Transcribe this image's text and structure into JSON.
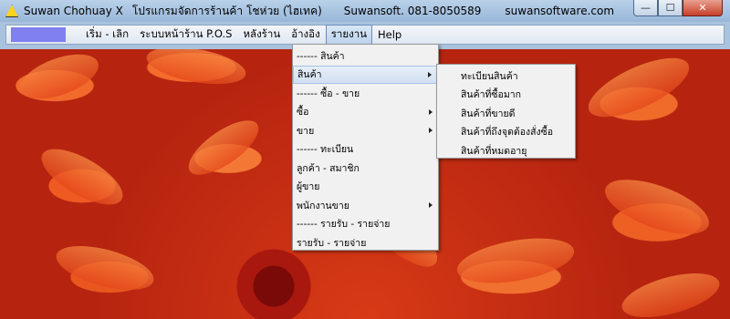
{
  "window": {
    "title_parts": [
      "Suwan Chohuay X",
      "โปรแกรมจัดการร้านค้า โชห่วย (ไฮเทค)",
      "Suwansoft. 081-8050589",
      "suwansoftware.com"
    ],
    "controls": {
      "minimize": "—",
      "maximize": "☐",
      "close": "✕"
    }
  },
  "menubar": {
    "items": [
      "เริ่ม - เลิก",
      "ระบบหน้าร้าน P.O.S",
      "หลังร้าน",
      "อ้างอิง",
      "รายงาน",
      "Help"
    ],
    "active": "รายงาน"
  },
  "report_menu": {
    "items": [
      {
        "label": "------  สินค้า",
        "type": "header"
      },
      {
        "label": "สินค้า",
        "submenu": true,
        "highlighted": true
      },
      {
        "label": "------  ซื้อ - ขาย",
        "type": "header"
      },
      {
        "label": "ซื้อ",
        "submenu": true
      },
      {
        "label": "ขาย",
        "submenu": true
      },
      {
        "label": "------  ทะเบียน",
        "type": "header"
      },
      {
        "label": "ลูกค้า - สมาชิก"
      },
      {
        "label": "ผู้ขาย"
      },
      {
        "label": "พนักงานขาย",
        "submenu": true
      },
      {
        "label": "------  รายรับ - รายจ่าย",
        "type": "header"
      },
      {
        "label": "รายรับ - รายจ่าย"
      }
    ]
  },
  "product_submenu": {
    "items": [
      "ทะเบียนสินค้า",
      "สินค้าที่ซื้อมาก",
      "สินค้าที่ขายดี",
      "สินค้าที่ถึงจุดต้องสั่งซื้อ",
      "สินค้าที่หมดอายุ"
    ]
  },
  "colors": {
    "menu_swatch": "#8080f0",
    "title_bar": "#b9d1ea",
    "close_button": "#c8402a"
  }
}
